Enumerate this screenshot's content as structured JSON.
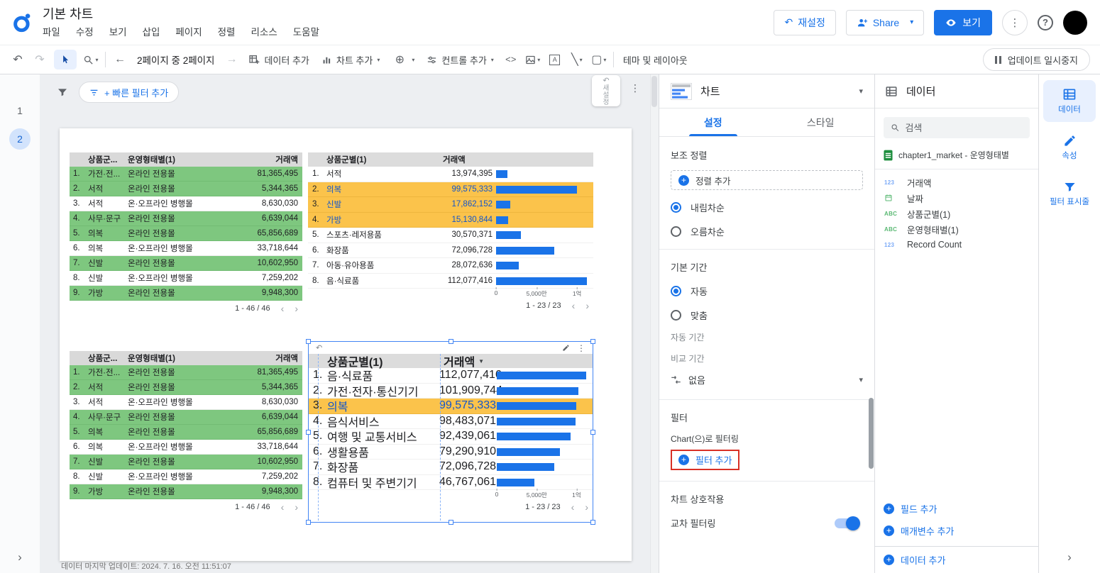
{
  "header": {
    "title": "기본 차트",
    "menu": [
      "파일",
      "수정",
      "보기",
      "삽입",
      "페이지",
      "정렬",
      "리소스",
      "도움말"
    ],
    "reset_label": "재설정",
    "share_label": "Share",
    "view_label": "보기"
  },
  "toolbar": {
    "page_indicator": "2페이지 중 2페이지",
    "add_data": "데이터 추가",
    "add_chart": "차트 추가",
    "add_control": "컨트롤 추가",
    "theme_layout": "테마 및 레이아웃",
    "pause_updates": "업데이트 일시중지"
  },
  "page_rail": {
    "pages": [
      "1",
      "2"
    ],
    "current_page": "2"
  },
  "canvas": {
    "quick_filter_label": "+ 빠른 필터 추가",
    "mini_panel_text": "새설정",
    "last_updated": "데이터 마지막 업데이트: 2024. 7. 16. 오전 11:51:07",
    "table_left": {
      "headers": {
        "dim1": "상품군...",
        "dim2": "운영형태별(1)",
        "metric": "거래액"
      },
      "rows": [
        {
          "n": "1.",
          "c1": "가전·전...",
          "c2": "온라인 전용몰",
          "v": "81,365,495",
          "hl": true
        },
        {
          "n": "2.",
          "c1": "서적",
          "c2": "온라인 전용몰",
          "v": "5,344,365",
          "hl": true
        },
        {
          "n": "3.",
          "c1": "서적",
          "c2": "온·오프라인 병행몰",
          "v": "8,630,030",
          "hl": false
        },
        {
          "n": "4.",
          "c1": "사무·문구",
          "c2": "온라인 전용몰",
          "v": "6,639,044",
          "hl": true
        },
        {
          "n": "5.",
          "c1": "의복",
          "c2": "온라인 전용몰",
          "v": "65,856,689",
          "hl": true
        },
        {
          "n": "6.",
          "c1": "의복",
          "c2": "온·오프라인 병행몰",
          "v": "33,718,644",
          "hl": false
        },
        {
          "n": "7.",
          "c1": "신발",
          "c2": "온라인 전용몰",
          "v": "10,602,950",
          "hl": true
        },
        {
          "n": "8.",
          "c1": "신발",
          "c2": "온·오프라인 병행몰",
          "v": "7,259,202",
          "hl": false
        },
        {
          "n": "9.",
          "c1": "가방",
          "c2": "온라인 전용몰",
          "v": "9,948,300",
          "hl": true
        }
      ],
      "pagination": "1 - 46 / 46"
    },
    "bar_table_top": {
      "headers": {
        "dim": "상품군별(1)",
        "metric": "거래액",
        "sorted": false
      },
      "rows": [
        {
          "n": "1.",
          "label": "서적",
          "display": "13,974,395",
          "value": 13974395,
          "hl": false
        },
        {
          "n": "2.",
          "label": "의복",
          "display": "99,575,333",
          "value": 99575333,
          "hl": true
        },
        {
          "n": "3.",
          "label": "신발",
          "display": "17,862,152",
          "value": 17862152,
          "hl": true
        },
        {
          "n": "4.",
          "label": "가방",
          "display": "15,130,844",
          "value": 15130844,
          "hl": true
        },
        {
          "n": "5.",
          "label": "스포츠·레저용품",
          "display": "30,570,371",
          "value": 30570371,
          "hl": false
        },
        {
          "n": "6.",
          "label": "화장품",
          "display": "72,096,728",
          "value": 72096728,
          "hl": false
        },
        {
          "n": "7.",
          "label": "아동·유아용품",
          "display": "28,072,636",
          "value": 28072636,
          "hl": false
        },
        {
          "n": "8.",
          "label": "음·식료품",
          "display": "112,077,416",
          "value": 112077416,
          "hl": false
        }
      ],
      "axis": [
        "0",
        "5,000만",
        "1억"
      ],
      "pagination": "1 - 23 / 23"
    },
    "bar_table_bottom": {
      "headers": {
        "dim": "상품군별(1)",
        "metric": "거래액",
        "sorted": true
      },
      "rows": [
        {
          "n": "1.",
          "label": "음·식료품",
          "display": "112,077,416",
          "value": 112077416,
          "hl": false
        },
        {
          "n": "2.",
          "label": "가전·전자·통신기기",
          "display": "101,909,744",
          "value": 101909744,
          "hl": false
        },
        {
          "n": "3.",
          "label": "의복",
          "display": "99,575,333",
          "value": 99575333,
          "hl": true
        },
        {
          "n": "4.",
          "label": "음식서비스",
          "display": "98,483,071",
          "value": 98483071,
          "hl": false
        },
        {
          "n": "5.",
          "label": "여행 및 교통서비스",
          "display": "92,439,061",
          "value": 92439061,
          "hl": false
        },
        {
          "n": "6.",
          "label": "생활용품",
          "display": "79,290,910",
          "value": 79290910,
          "hl": false
        },
        {
          "n": "7.",
          "label": "화장품",
          "display": "72,096,728",
          "value": 72096728,
          "hl": false
        },
        {
          "n": "8.",
          "label": "컴퓨터 및 주변기기",
          "display": "46,767,061",
          "value": 46767061,
          "hl": false
        }
      ],
      "axis": [
        "0",
        "5,000만",
        "1억"
      ],
      "pagination": "1 - 23 / 23"
    }
  },
  "properties": {
    "panel_title": "차트",
    "tabs": [
      "설정",
      "스타일"
    ],
    "secondary_sort": "보조 정렬",
    "add_sort": "정렬 추가",
    "desc": "내림차순",
    "asc": "오름차순",
    "default_range": "기본 기간",
    "auto": "자동",
    "custom": "맞춤",
    "auto_period": "자동 기간",
    "compare_period": "비교 기간",
    "none": "없음",
    "filter": "필터",
    "filter_by": "Chart(으)로 필터링",
    "add_filter": "필터 추가",
    "interactions": "차트 상호작용",
    "cross_filtering": "교차 필터링",
    "cross_filtering_on": true
  },
  "data_panel": {
    "title": "데이터",
    "search_placeholder": "검색",
    "source": "chapter1_market - 운영형태별",
    "fields": [
      {
        "type": "number",
        "name": "거래액"
      },
      {
        "type": "date",
        "name": "날짜"
      },
      {
        "type": "text",
        "name": "상품군별(1)"
      },
      {
        "type": "text",
        "name": "운영형태별(1)"
      },
      {
        "type": "number",
        "name": "Record Count"
      }
    ],
    "add_field": "필드 추가",
    "add_parameter": "매개변수 추가",
    "add_data": "데이터 추가"
  },
  "right_rail": {
    "data": "데이터",
    "properties": "속성",
    "filter_bar": "필터 표시줄"
  },
  "colors": {
    "accent": "#1a73e8",
    "bar": "#1a73e8",
    "row_green": "#7ec77f",
    "row_yellow": "#fbc34b",
    "annotation_red": "#d93025"
  }
}
